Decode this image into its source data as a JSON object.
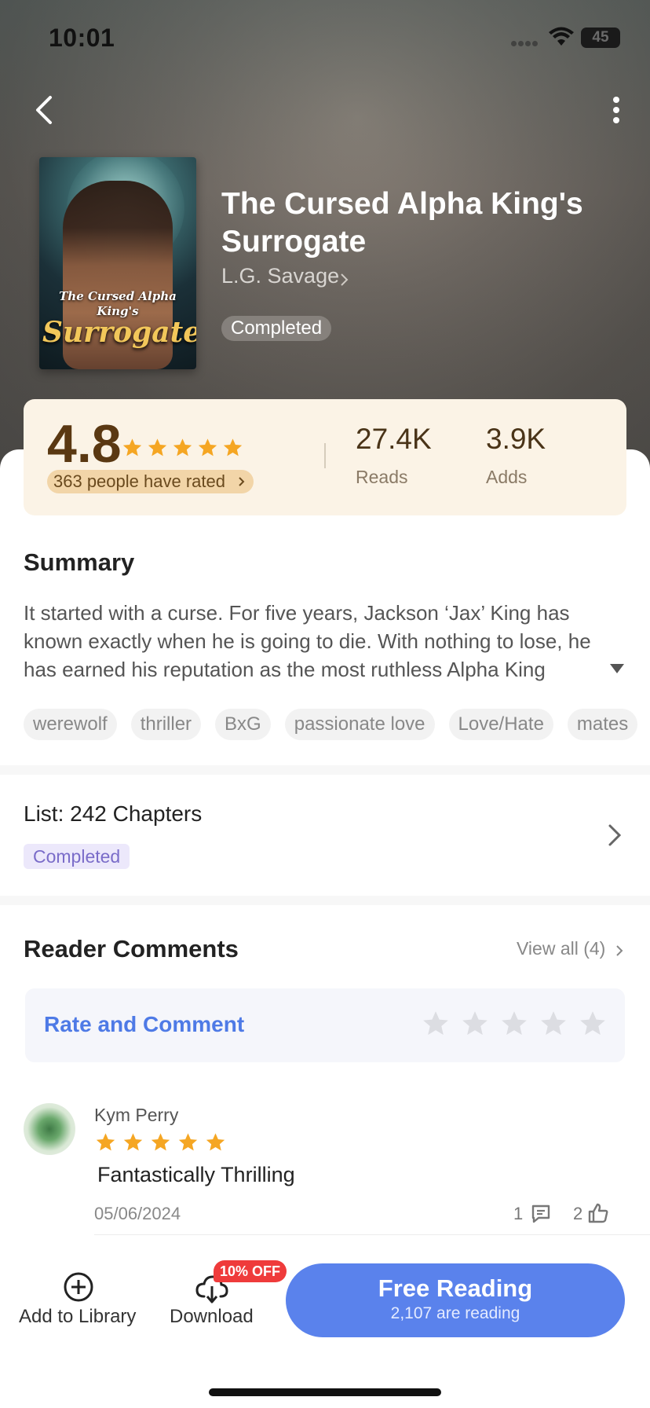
{
  "status_bar": {
    "time": "10:01",
    "battery": "45"
  },
  "book": {
    "title": "The Cursed Alpha King's Surrogate",
    "author": "L.G. Savage",
    "status": "Completed",
    "cover_title_small": "The Cursed Alpha King's",
    "cover_title_big": "Surrogate"
  },
  "rating": {
    "score": "4.8",
    "stars": 5,
    "rated_text": "363 people have rated",
    "reads_value": "27.4K",
    "reads_label": "Reads",
    "adds_value": "3.9K",
    "adds_label": "Adds"
  },
  "summary": {
    "title": "Summary",
    "text": "It started with a curse. For five years, Jackson ‘Jax’ King has known exactly when he is going to die. With nothing to lose, he has earned his reputation as the most ruthless Alpha King"
  },
  "tags": [
    "werewolf",
    "thriller",
    "BxG",
    "passionate love",
    "Love/Hate",
    "mates"
  ],
  "chapters": {
    "label": "List: 242 Chapters",
    "status": "Completed"
  },
  "comments": {
    "title": "Reader Comments",
    "view_all": "View all (4)",
    "rate_label": "Rate and Comment",
    "items": [
      {
        "name": "Kym Perry",
        "stars": 5,
        "text": "Fantastically Thrilling",
        "date": "05/06/2024",
        "replies": "1",
        "likes": "2"
      }
    ]
  },
  "bottom_bar": {
    "add_library": "Add to Library",
    "download": "Download",
    "discount_badge": "10% OFF",
    "free_reading": "Free Reading",
    "reading_count": "2,107 are reading"
  },
  "colors": {
    "accent": "#5a82ec",
    "star": "#f5a623",
    "rating_card": "#fbf3e6",
    "badge_red": "#ef3b3b"
  }
}
